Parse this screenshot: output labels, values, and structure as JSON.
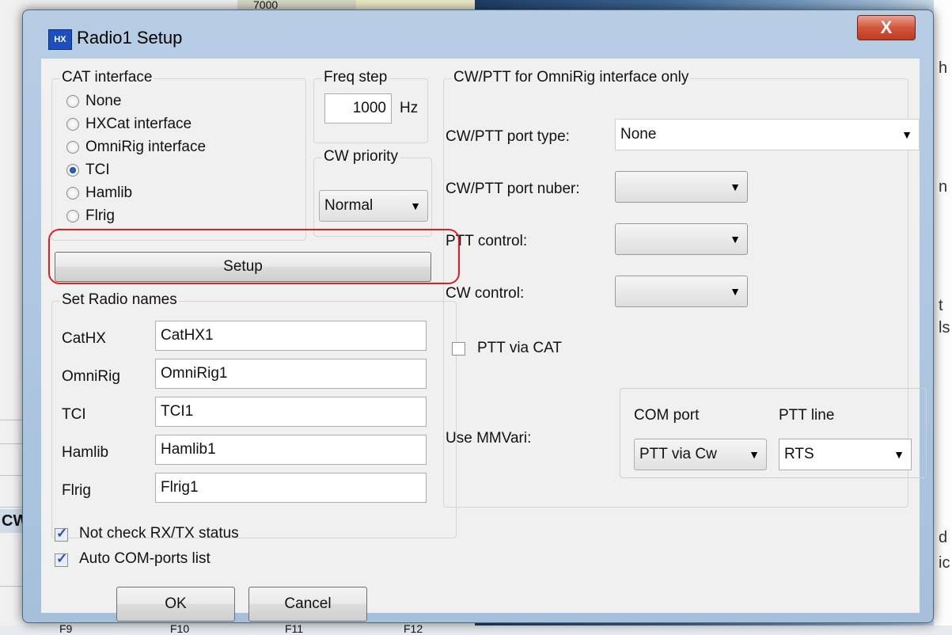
{
  "background": {
    "left_tabs": "CW",
    "bottom_cells": [
      "F9",
      "F10",
      "F11",
      "F12"
    ],
    "top_number": "7000",
    "edge_chars": [
      "h",
      "n",
      "t",
      "ls",
      "d",
      "ic"
    ]
  },
  "window": {
    "title": "Radio1 Setup",
    "icon_text": "HX",
    "close_glyph": "X"
  },
  "cat_interface": {
    "legend": "CAT interface",
    "options": [
      {
        "label": "None",
        "selected": false
      },
      {
        "label": "HXCat interface",
        "selected": false
      },
      {
        "label": "OmniRig interface",
        "selected": false
      },
      {
        "label": "TCI",
        "selected": true
      },
      {
        "label": "Hamlib",
        "selected": false
      },
      {
        "label": "Flrig",
        "selected": false
      }
    ]
  },
  "freq_step": {
    "legend": "Freq step",
    "value": "1000",
    "unit": "Hz"
  },
  "cw_priority": {
    "legend": "CW priority",
    "value": "Normal"
  },
  "setup_button": "Setup",
  "radio_names": {
    "legend": "Set Radio names",
    "rows": [
      {
        "label": "CatHX",
        "value": "CatHX1"
      },
      {
        "label": "OmniRig",
        "value": "OmniRig1"
      },
      {
        "label": "TCI",
        "value": "TCI1"
      },
      {
        "label": "Hamlib",
        "value": "Hamlib1"
      },
      {
        "label": "Flrig",
        "value": "Flrig1"
      }
    ]
  },
  "cwptt": {
    "legend": "CW/PTT for OmniRig interface only",
    "port_type_label": "CW/PTT port type:",
    "port_type_value": "None",
    "port_number_label": "CW/PTT port nuber:",
    "ptt_control_label": "PTT control:",
    "cw_control_label": "CW control:",
    "ptt_via_cat_label": "PTT via CAT",
    "ptt_via_cat_checked": false,
    "use_mmvari_label": "Use MMVari:",
    "com_port_label": "COM port",
    "com_port_value": "PTT via Cw",
    "ptt_line_label": "PTT line",
    "ptt_line_value": "RTS"
  },
  "options": {
    "not_check_rxtx": "Not check RX/TX status",
    "not_check_rxtx_checked": true,
    "auto_com_ports": "Auto COM-ports list",
    "auto_com_ports_checked": true
  },
  "buttons": {
    "ok": "OK",
    "cancel": "Cancel"
  },
  "colors": {
    "highlight": "#e02020",
    "dialog_frame": "#a6c0dc",
    "client_bg": "#f0f0f0"
  }
}
